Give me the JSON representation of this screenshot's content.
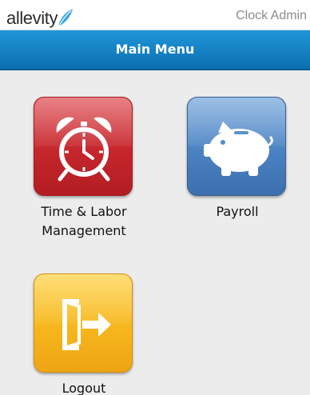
{
  "header": {
    "brand": "allevity",
    "user_role": "Clock Admin"
  },
  "titlebar": {
    "title": "Main Menu"
  },
  "menu": {
    "items": [
      {
        "label_line1": "Time & Labor",
        "label_line2": "Management",
        "icon": "alarm-clock-icon",
        "color": "#c5262c"
      },
      {
        "label_line1": "Payroll",
        "icon": "piggy-bank-icon",
        "color": "#4b82c2"
      },
      {
        "label_line1": "Logout",
        "icon": "exit-door-icon",
        "color": "#f6b61d"
      }
    ]
  },
  "colors": {
    "titlebar": "#0d6fb0",
    "brand_leaf": "#3aa7e0"
  }
}
